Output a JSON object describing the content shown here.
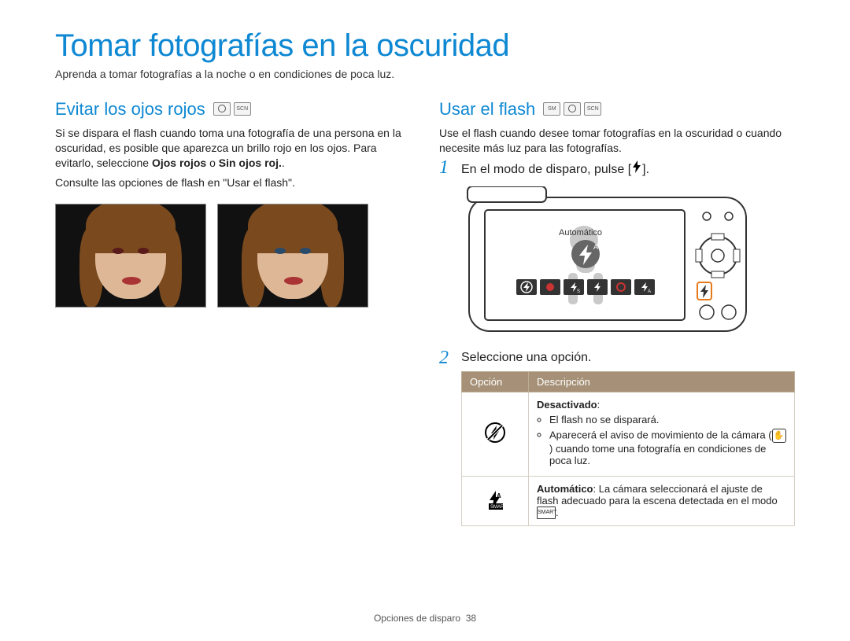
{
  "title": "Tomar fotografías en la oscuridad",
  "intro": "Aprenda a tomar fotografías a la noche o en condiciones de poca luz.",
  "left": {
    "heading": "Evitar los ojos rojos",
    "p1": "Si se dispara el flash cuando toma una fotografía de una persona en la oscuridad, es posible que aparezca un brillo rojo en los ojos. Para evitarlo, seleccione ",
    "bold1": "Ojos rojos",
    "or": " o ",
    "bold2": "Sin ojos roj.",
    "p2": "Consulte las opciones de flash en \"Usar el flash\"."
  },
  "right": {
    "heading": "Usar el flash",
    "p1": "Use el flash cuando desee tomar fotografías en la oscuridad o cuando necesite más luz para las fotografías.",
    "step1a": "En el modo de disparo, pulse [",
    "step1b": "].",
    "step2": "Seleccione una opción.",
    "cameraLabel": "Automático"
  },
  "table": {
    "h1": "Opción",
    "h2": "Descripción",
    "row1": {
      "title": "Desactivado",
      "b1": "El flash no se disparará.",
      "b2a": "Aparecerá el aviso de movimiento de la cámara (",
      "b2b": ") cuando tome una fotografía en condiciones de poca luz."
    },
    "row2": {
      "title": "Automático",
      "rest": ": La cámara seleccionará el ajuste de flash adecuado para la escena detectada en el modo ",
      "end": "."
    }
  },
  "footer": {
    "section": "Opciones de disparo",
    "page": "38"
  }
}
